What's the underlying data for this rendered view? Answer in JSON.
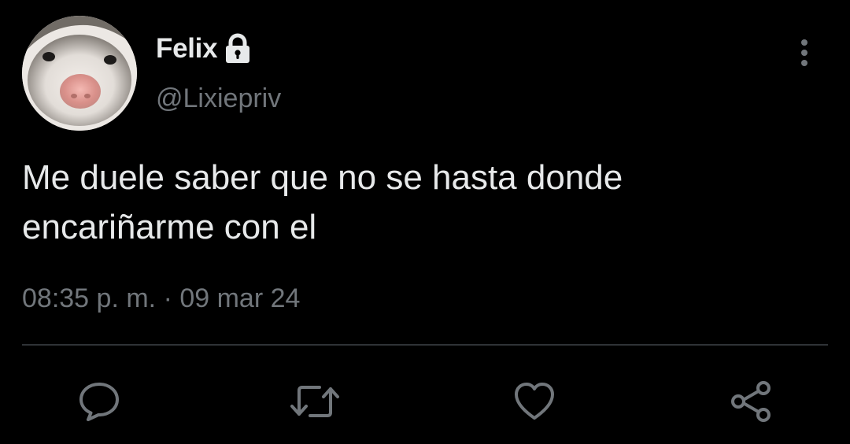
{
  "tweet": {
    "author": {
      "display_name": "Felix",
      "handle": "@Lixiepriv",
      "protected_icon": "lock-icon",
      "avatar": "ferret-avatar"
    },
    "text_lines": [
      "Me duele saber que no se hasta donde",
      "encariñarme con el"
    ],
    "time": "08:35 p. m.",
    "separator": "·",
    "date": "09 mar 24",
    "menu_icon": "more-vertical-icon"
  },
  "actions": [
    {
      "icon": "reply-icon"
    },
    {
      "icon": "retweet-icon"
    },
    {
      "icon": "like-icon"
    },
    {
      "icon": "share-icon"
    }
  ],
  "colors": {
    "background": "#000000",
    "primary_text": "#e7e9ea",
    "secondary_text": "#71767b",
    "divider": "#2f3336"
  }
}
